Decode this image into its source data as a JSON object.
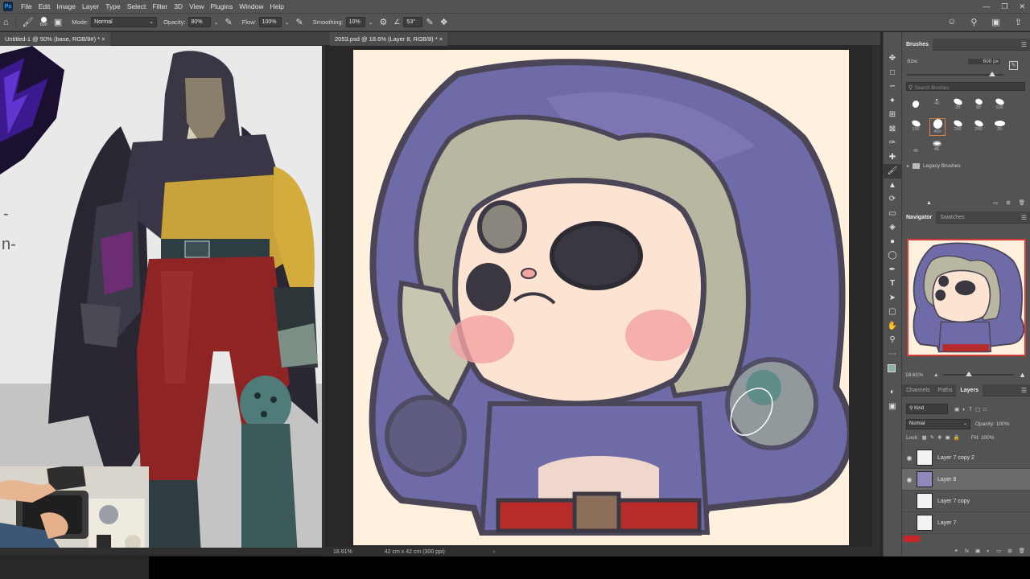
{
  "app": {
    "logo": "Ps"
  },
  "menu": [
    "File",
    "Edit",
    "Image",
    "Layer",
    "Type",
    "Select",
    "Filter",
    "3D",
    "View",
    "Plugins",
    "Window",
    "Help"
  ],
  "options_bar": {
    "brush_size": "600",
    "mode_label": "Mode:",
    "mode_value": "Normal",
    "opacity_label": "Opacity:",
    "opacity_value": "80%",
    "flow_label": "Flow:",
    "flow_value": "100%",
    "smoothing_label": "Smoothing:",
    "smoothing_value": "10%",
    "angle_value": "53°"
  },
  "documents": {
    "left_tab": "Untitled-1 @ 50% (base, RGB/8#) *",
    "right_tab": "2053.psd @ 18.6% (Layer 8, RGB/8) *"
  },
  "left_doc_text": [
    "-",
    "n-"
  ],
  "status_bar": {
    "zoom": "18.61%",
    "doc_size": "42 cm x 42 cm (300 ppi)"
  },
  "brushes_panel": {
    "tab": "Brushes",
    "size_label": "Size:",
    "size_value": "600 px",
    "size_fraction": 0.88,
    "search_placeholder": "Search Brushes",
    "presets": [
      "40",
      "20",
      "80",
      "100",
      "400",
      "150",
      "200",
      "30",
      "45",
      "45"
    ],
    "group": "Legacy Brushes"
  },
  "navigator_panel": {
    "tabs": [
      "Navigator",
      "Swatches"
    ],
    "zoom": "18.61%",
    "zoom_fraction": 0.35
  },
  "layers_panel": {
    "tabs": [
      "Channels",
      "Paths",
      "Layers"
    ],
    "filter_kind": "Kind",
    "blend_mode": "Normal",
    "opacity_label": "Opacity:",
    "opacity_value": "100%",
    "lock_label": "Lock:",
    "fill_label": "Fill:",
    "fill_value": "100%",
    "layers": [
      {
        "name": "Layer 7 copy 2",
        "visible": true,
        "selected": false
      },
      {
        "name": "Layer 8",
        "visible": true,
        "selected": true
      },
      {
        "name": "Layer 7 copy",
        "visible": false,
        "selected": false
      },
      {
        "name": "Layer 7",
        "visible": false,
        "selected": false
      }
    ]
  },
  "colors": {
    "accent_blue": "#31a8ff",
    "foreground_color": "#8fb0a5",
    "hood_purple": "#6f6aa8",
    "canvas_cream": "#fff1de",
    "belt_red": "#b72b2b"
  }
}
